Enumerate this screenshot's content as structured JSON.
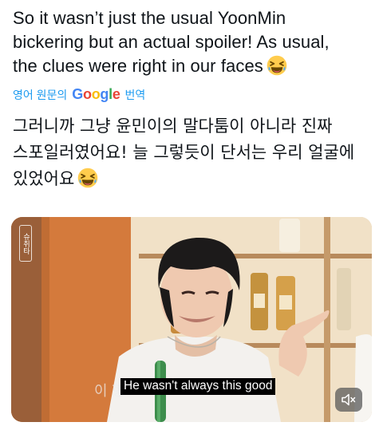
{
  "tweet": {
    "lines": [
      "So it wasn’t just the usual YoonMin",
      "bickering but an actual spoiler! As usual,",
      "the clues were right in our faces"
    ],
    "emoji": "laughing-face"
  },
  "translate": {
    "prefix": "영어 원문의",
    "google": "Google",
    "suffix": "번역"
  },
  "translated": {
    "lines": [
      "그러니까 그냥 윤민이의 말다툼이 아니라 진짜",
      "스포일러였어요! 늘 그렇듯이 단서는 우리 얼굴에",
      "있었어요"
    ]
  },
  "video": {
    "subtitle": "He wasn't always this good",
    "caption_ko": "이 형",
    "logo_text": "슈취타",
    "muted": true
  },
  "colors": {
    "link": "#1d9bf0",
    "text": "#0f1419"
  }
}
